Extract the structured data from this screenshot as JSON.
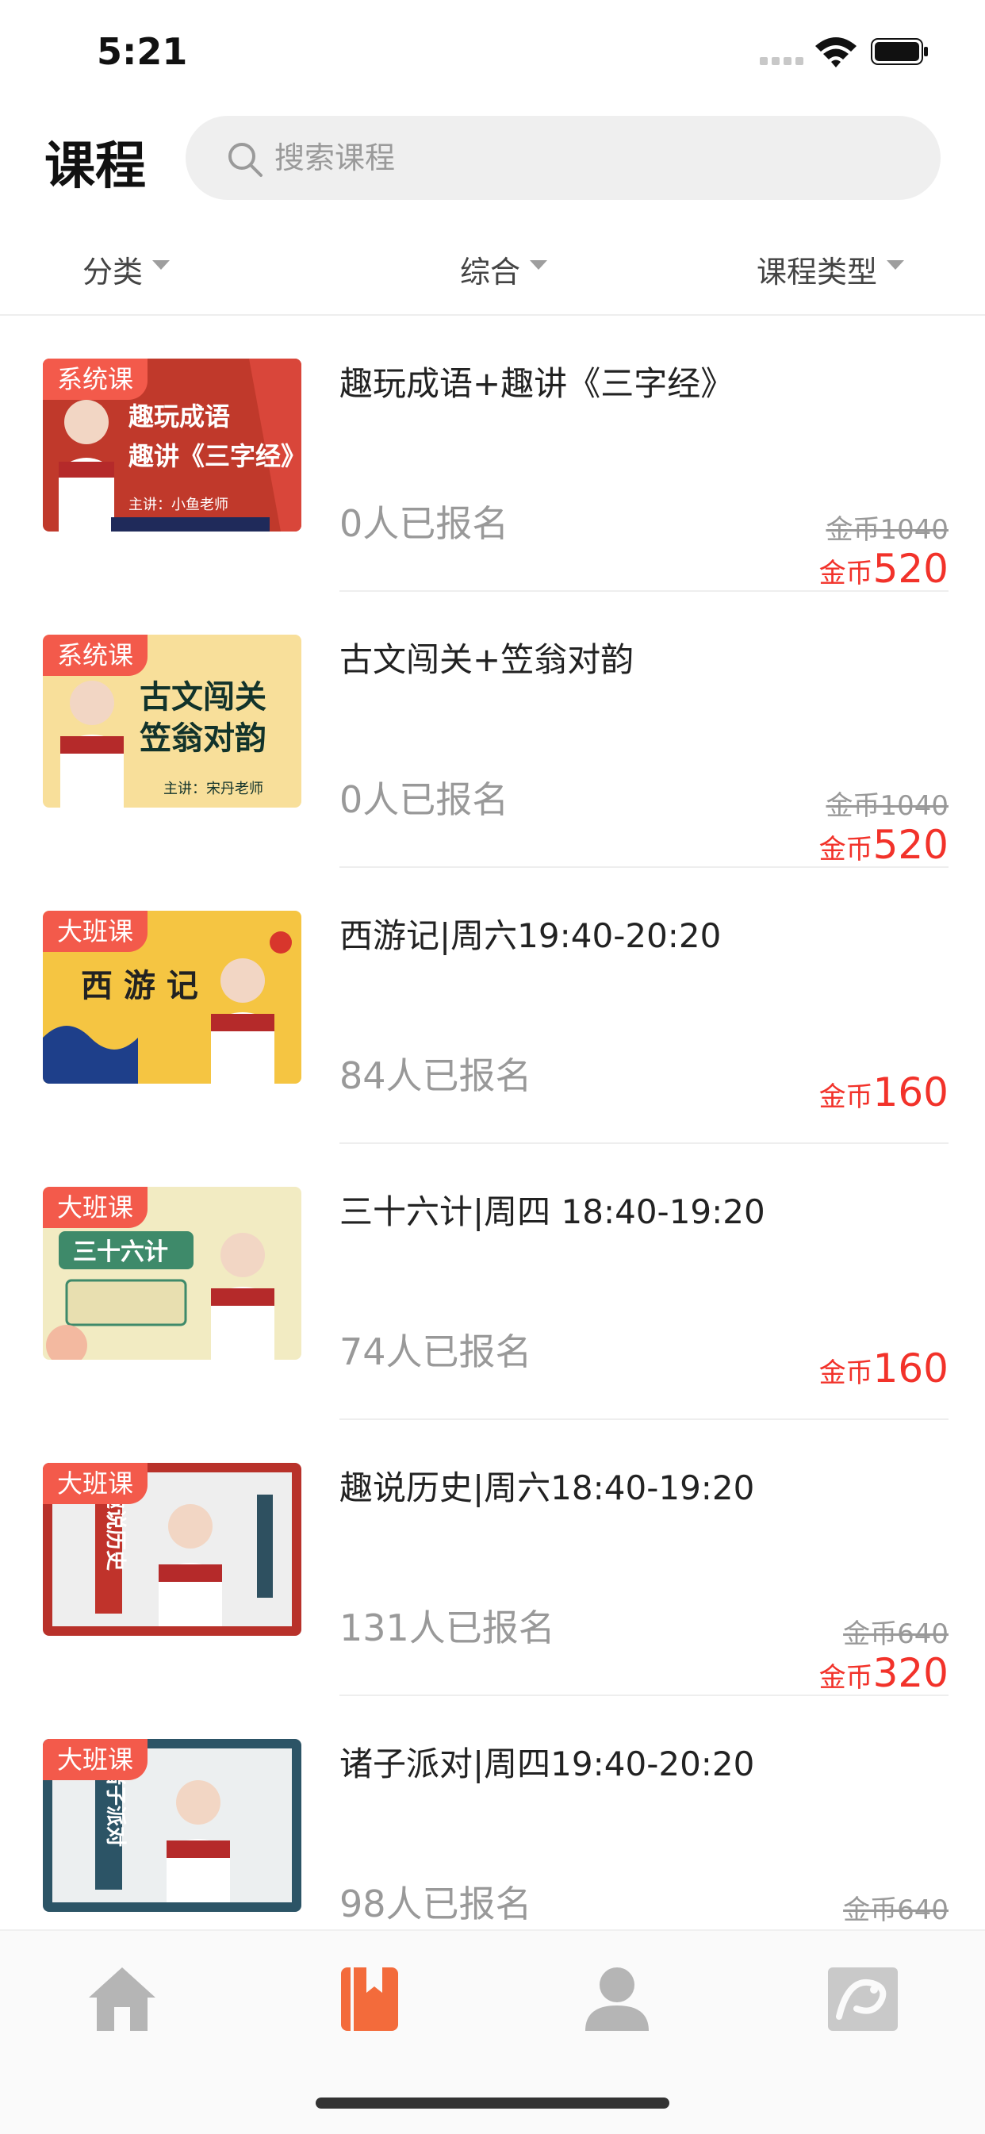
{
  "status_bar": {
    "time": "5:21"
  },
  "header": {
    "title": "课程",
    "search_placeholder": "搜索课程"
  },
  "filters": [
    {
      "label": "分类"
    },
    {
      "label": "综合"
    },
    {
      "label": "课程类型"
    }
  ],
  "courses": [
    {
      "badge": "系统课",
      "thumb_lines": [
        "趣玩成语",
        "趣讲《三字经》"
      ],
      "thumb_teacher": "主讲：小鱼老师",
      "title": "趣玩成语+趣讲《三字经》",
      "enrolled": "0人已报名",
      "original_price": "金币1040",
      "price_unit": "金币",
      "price": "520"
    },
    {
      "badge": "系统课",
      "thumb_lines": [
        "古文闯关",
        "笠翁对韵"
      ],
      "thumb_teacher": "主讲：宋丹老师",
      "title": "古文闯关+笠翁对韵",
      "enrolled": "0人已报名",
      "original_price": "金币1040",
      "price_unit": "金币",
      "price": "520"
    },
    {
      "badge": "大班课",
      "thumb_lines": [
        "西 游 记"
      ],
      "title": "西游记|周六19:40-20:20",
      "enrolled": "84人已报名",
      "original_price": "",
      "price_unit": "金币",
      "price": "160"
    },
    {
      "badge": "大班课",
      "thumb_lines": [
        "三十六计"
      ],
      "title": "三十六计|周四 18:40-19:20",
      "enrolled": "74人已报名",
      "original_price": "",
      "price_unit": "金币",
      "price": "160"
    },
    {
      "badge": "大班课",
      "thumb_lines": [
        "趣说历史"
      ],
      "title": "趣说历史|周六18:40-19:20",
      "enrolled": "131人已报名",
      "original_price": "金币640",
      "price_unit": "金币",
      "price": "320"
    },
    {
      "badge": "大班课",
      "thumb_lines": [
        "诸子派对"
      ],
      "title": "诸子派对|周四19:40-20:20",
      "enrolled": "98人已报名",
      "original_price": "金币640",
      "price_unit": "",
      "price": ""
    }
  ],
  "tab_bar": {
    "tabs": [
      {
        "icon": "home-icon",
        "active": false
      },
      {
        "icon": "course-book-icon",
        "active": true
      },
      {
        "icon": "profile-icon",
        "active": false
      },
      {
        "icon": "dragon-logo-icon",
        "active": false
      }
    ],
    "active_color": "#f36b3b",
    "inactive_color": "#b5b5b5"
  },
  "colors": {
    "accent_red": "#f2322a",
    "badge_red": "#f35a4b"
  }
}
